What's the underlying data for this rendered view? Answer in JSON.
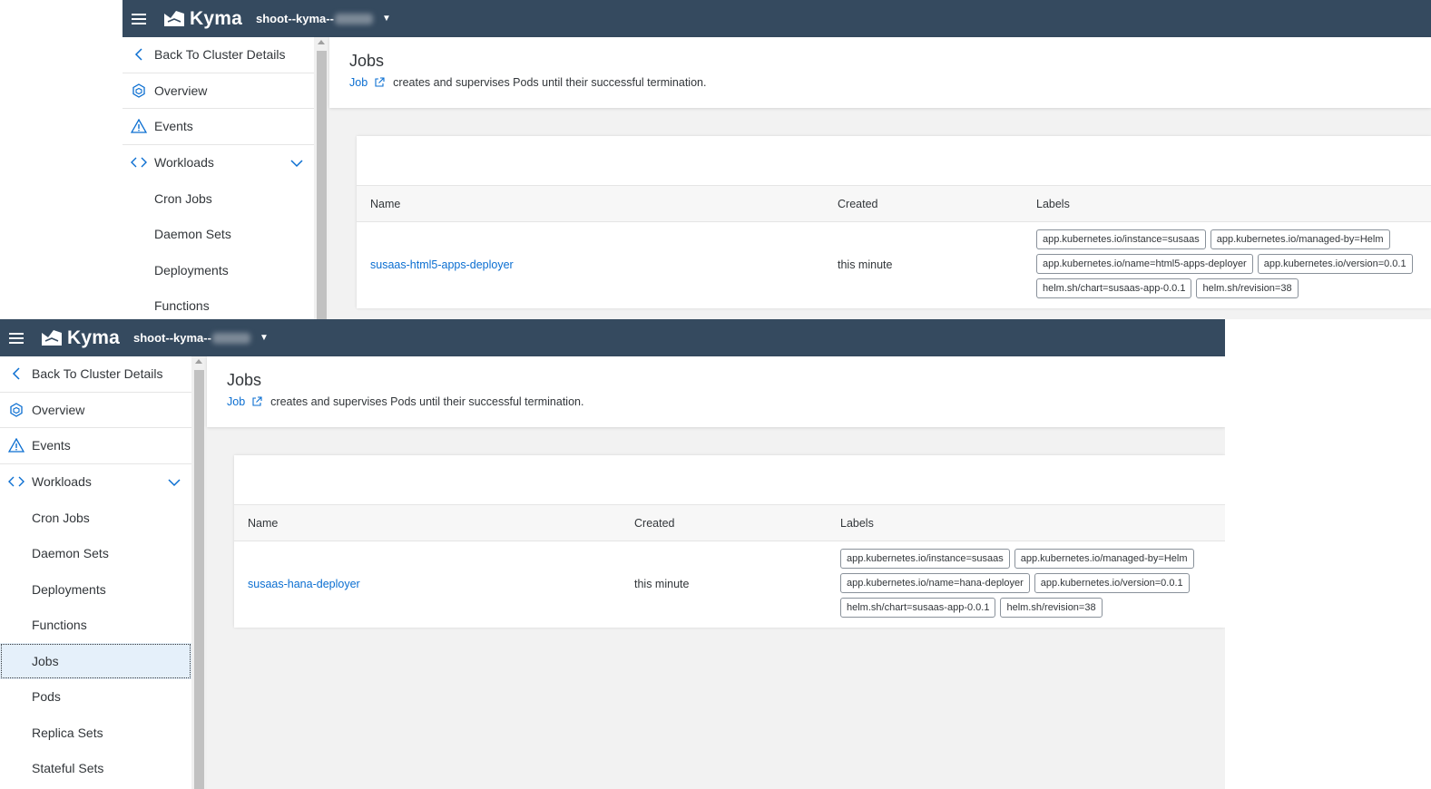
{
  "app": {
    "brand": "Kyma",
    "cluster_name": "shoot--kyma--"
  },
  "colors": {
    "shell_bg": "#354a5f",
    "link": "#0a6ed1",
    "selected_bg": "#e5f0fa"
  },
  "icons": {
    "menu": "hamburger-icon",
    "logo": "kyma-logo",
    "back": "chevron-left-icon",
    "overview": "cube-icon",
    "events": "warning-icon",
    "workloads": "code-brackets-icon",
    "expand": "chevron-down-icon",
    "external": "external-link-icon"
  },
  "sidebar": {
    "back": "Back To Cluster Details",
    "overview": "Overview",
    "events": "Events",
    "workloads": "Workloads",
    "sub_items": [
      "Cron Jobs",
      "Daemon Sets",
      "Deployments",
      "Functions",
      "Jobs",
      "Pods",
      "Replica Sets",
      "Stateful Sets"
    ],
    "selected": "Jobs"
  },
  "page": {
    "title": "Jobs",
    "doc_link": "Job",
    "description": "creates and supervises Pods until their successful termination."
  },
  "table": {
    "columns": [
      "Name",
      "Created",
      "Labels"
    ]
  },
  "windows": [
    {
      "row": {
        "name": "susaas-html5-apps-deployer",
        "created": "this minute",
        "labels": [
          "app.kubernetes.io/instance=susaas",
          "app.kubernetes.io/managed-by=Helm",
          "app.kubernetes.io/name=html5-apps-deployer",
          "app.kubernetes.io/version=0.0.1",
          "helm.sh/chart=susaas-app-0.0.1",
          "helm.sh/revision=38"
        ]
      }
    },
    {
      "row": {
        "name": "susaas-hana-deployer",
        "created": "this minute",
        "labels": [
          "app.kubernetes.io/instance=susaas",
          "app.kubernetes.io/managed-by=Helm",
          "app.kubernetes.io/name=hana-deployer",
          "app.kubernetes.io/version=0.0.1",
          "helm.sh/chart=susaas-app-0.0.1",
          "helm.sh/revision=38"
        ]
      }
    }
  ]
}
